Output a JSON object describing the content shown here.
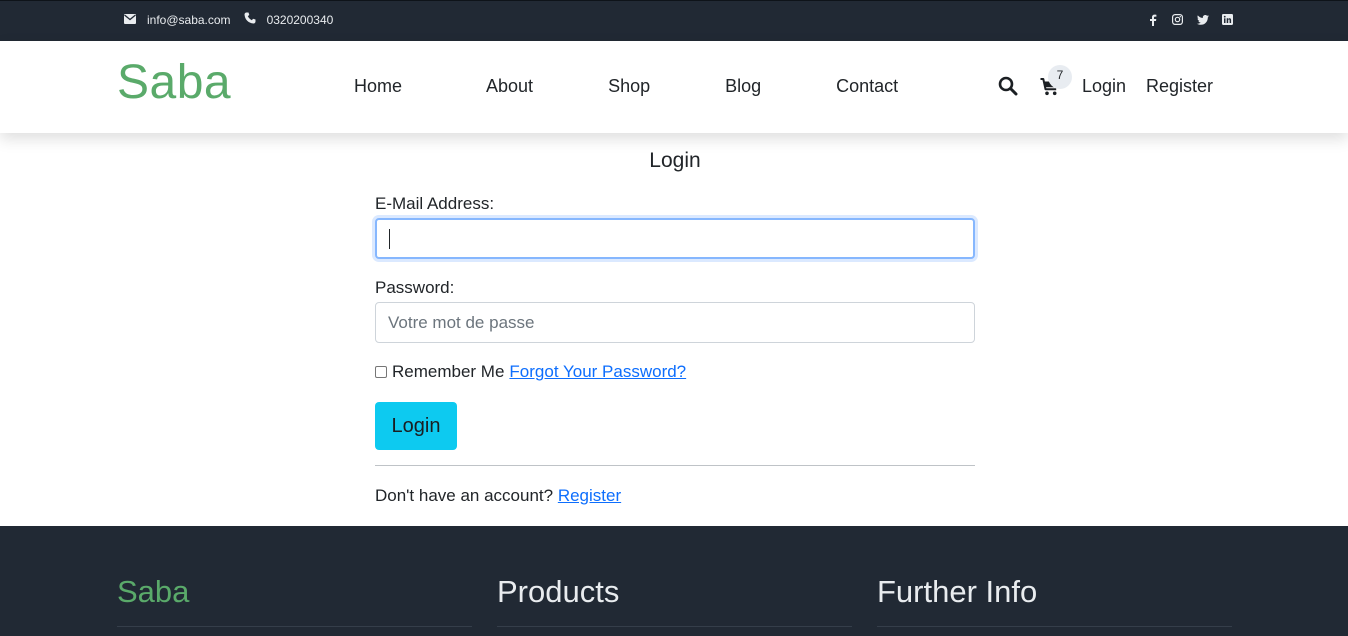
{
  "topbar": {
    "email": "info@saba.com",
    "phone": "0320200340",
    "social_icons": [
      "facebook-icon",
      "instagram-icon",
      "twitter-icon",
      "linkedin-icon"
    ]
  },
  "header": {
    "logo": "Saba",
    "nav": [
      "Home",
      "About",
      "Shop",
      "Blog",
      "Contact"
    ],
    "cart_count": "7",
    "login": "Login",
    "register": "Register"
  },
  "form": {
    "title": "Login",
    "email_label": "E-Mail Address:",
    "email_value": "",
    "password_label": "Password:",
    "password_placeholder": "Votre mot de passe",
    "remember_label": "Remember Me",
    "forgot_link": "Forgot Your Password?",
    "submit": "Login",
    "no_account_text": "Don't have an account?",
    "register_link": "Register"
  },
  "footer": {
    "col1_title": "Saba",
    "col2_title": "Products",
    "col3_title": "Further Info"
  },
  "colors": {
    "dark_bar": "#212934",
    "brand_green": "#5aaa6a",
    "link_blue": "#0d6efd",
    "button_cyan": "#0dcaf0"
  }
}
